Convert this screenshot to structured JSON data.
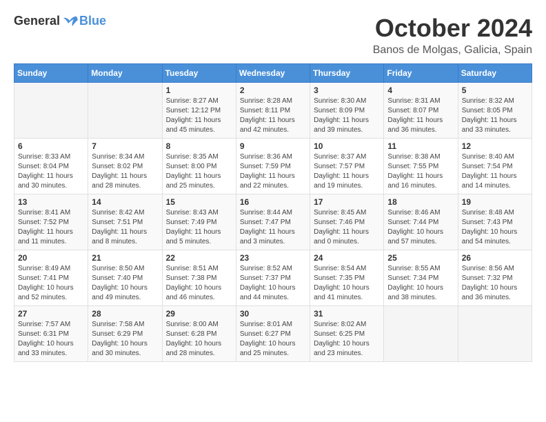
{
  "logo": {
    "general": "General",
    "blue": "Blue"
  },
  "title": "October 2024",
  "location": "Banos de Molgas, Galicia, Spain",
  "weekdays": [
    "Sunday",
    "Monday",
    "Tuesday",
    "Wednesday",
    "Thursday",
    "Friday",
    "Saturday"
  ],
  "weeks": [
    [
      {
        "day": "",
        "sunrise": "",
        "sunset": "",
        "daylight": ""
      },
      {
        "day": "",
        "sunrise": "",
        "sunset": "",
        "daylight": ""
      },
      {
        "day": "1",
        "sunrise": "Sunrise: 8:27 AM",
        "sunset": "Sunset: 12:12 PM",
        "daylight": "Daylight: 11 hours and 45 minutes."
      },
      {
        "day": "2",
        "sunrise": "Sunrise: 8:28 AM",
        "sunset": "Sunset: 8:11 PM",
        "daylight": "Daylight: 11 hours and 42 minutes."
      },
      {
        "day": "3",
        "sunrise": "Sunrise: 8:30 AM",
        "sunset": "Sunset: 8:09 PM",
        "daylight": "Daylight: 11 hours and 39 minutes."
      },
      {
        "day": "4",
        "sunrise": "Sunrise: 8:31 AM",
        "sunset": "Sunset: 8:07 PM",
        "daylight": "Daylight: 11 hours and 36 minutes."
      },
      {
        "day": "5",
        "sunrise": "Sunrise: 8:32 AM",
        "sunset": "Sunset: 8:05 PM",
        "daylight": "Daylight: 11 hours and 33 minutes."
      }
    ],
    [
      {
        "day": "6",
        "sunrise": "Sunrise: 8:33 AM",
        "sunset": "Sunset: 8:04 PM",
        "daylight": "Daylight: 11 hours and 30 minutes."
      },
      {
        "day": "7",
        "sunrise": "Sunrise: 8:34 AM",
        "sunset": "Sunset: 8:02 PM",
        "daylight": "Daylight: 11 hours and 28 minutes."
      },
      {
        "day": "8",
        "sunrise": "Sunrise: 8:35 AM",
        "sunset": "Sunset: 8:00 PM",
        "daylight": "Daylight: 11 hours and 25 minutes."
      },
      {
        "day": "9",
        "sunrise": "Sunrise: 8:36 AM",
        "sunset": "Sunset: 7:59 PM",
        "daylight": "Daylight: 11 hours and 22 minutes."
      },
      {
        "day": "10",
        "sunrise": "Sunrise: 8:37 AM",
        "sunset": "Sunset: 7:57 PM",
        "daylight": "Daylight: 11 hours and 19 minutes."
      },
      {
        "day": "11",
        "sunrise": "Sunrise: 8:38 AM",
        "sunset": "Sunset: 7:55 PM",
        "daylight": "Daylight: 11 hours and 16 minutes."
      },
      {
        "day": "12",
        "sunrise": "Sunrise: 8:40 AM",
        "sunset": "Sunset: 7:54 PM",
        "daylight": "Daylight: 11 hours and 14 minutes."
      }
    ],
    [
      {
        "day": "13",
        "sunrise": "Sunrise: 8:41 AM",
        "sunset": "Sunset: 7:52 PM",
        "daylight": "Daylight: 11 hours and 11 minutes."
      },
      {
        "day": "14",
        "sunrise": "Sunrise: 8:42 AM",
        "sunset": "Sunset: 7:51 PM",
        "daylight": "Daylight: 11 hours and 8 minutes."
      },
      {
        "day": "15",
        "sunrise": "Sunrise: 8:43 AM",
        "sunset": "Sunset: 7:49 PM",
        "daylight": "Daylight: 11 hours and 5 minutes."
      },
      {
        "day": "16",
        "sunrise": "Sunrise: 8:44 AM",
        "sunset": "Sunset: 7:47 PM",
        "daylight": "Daylight: 11 hours and 3 minutes."
      },
      {
        "day": "17",
        "sunrise": "Sunrise: 8:45 AM",
        "sunset": "Sunset: 7:46 PM",
        "daylight": "Daylight: 11 hours and 0 minutes."
      },
      {
        "day": "18",
        "sunrise": "Sunrise: 8:46 AM",
        "sunset": "Sunset: 7:44 PM",
        "daylight": "Daylight: 10 hours and 57 minutes."
      },
      {
        "day": "19",
        "sunrise": "Sunrise: 8:48 AM",
        "sunset": "Sunset: 7:43 PM",
        "daylight": "Daylight: 10 hours and 54 minutes."
      }
    ],
    [
      {
        "day": "20",
        "sunrise": "Sunrise: 8:49 AM",
        "sunset": "Sunset: 7:41 PM",
        "daylight": "Daylight: 10 hours and 52 minutes."
      },
      {
        "day": "21",
        "sunrise": "Sunrise: 8:50 AM",
        "sunset": "Sunset: 7:40 PM",
        "daylight": "Daylight: 10 hours and 49 minutes."
      },
      {
        "day": "22",
        "sunrise": "Sunrise: 8:51 AM",
        "sunset": "Sunset: 7:38 PM",
        "daylight": "Daylight: 10 hours and 46 minutes."
      },
      {
        "day": "23",
        "sunrise": "Sunrise: 8:52 AM",
        "sunset": "Sunset: 7:37 PM",
        "daylight": "Daylight: 10 hours and 44 minutes."
      },
      {
        "day": "24",
        "sunrise": "Sunrise: 8:54 AM",
        "sunset": "Sunset: 7:35 PM",
        "daylight": "Daylight: 10 hours and 41 minutes."
      },
      {
        "day": "25",
        "sunrise": "Sunrise: 8:55 AM",
        "sunset": "Sunset: 7:34 PM",
        "daylight": "Daylight: 10 hours and 38 minutes."
      },
      {
        "day": "26",
        "sunrise": "Sunrise: 8:56 AM",
        "sunset": "Sunset: 7:32 PM",
        "daylight": "Daylight: 10 hours and 36 minutes."
      }
    ],
    [
      {
        "day": "27",
        "sunrise": "Sunrise: 7:57 AM",
        "sunset": "Sunset: 6:31 PM",
        "daylight": "Daylight: 10 hours and 33 minutes."
      },
      {
        "day": "28",
        "sunrise": "Sunrise: 7:58 AM",
        "sunset": "Sunset: 6:29 PM",
        "daylight": "Daylight: 10 hours and 30 minutes."
      },
      {
        "day": "29",
        "sunrise": "Sunrise: 8:00 AM",
        "sunset": "Sunset: 6:28 PM",
        "daylight": "Daylight: 10 hours and 28 minutes."
      },
      {
        "day": "30",
        "sunrise": "Sunrise: 8:01 AM",
        "sunset": "Sunset: 6:27 PM",
        "daylight": "Daylight: 10 hours and 25 minutes."
      },
      {
        "day": "31",
        "sunrise": "Sunrise: 8:02 AM",
        "sunset": "Sunset: 6:25 PM",
        "daylight": "Daylight: 10 hours and 23 minutes."
      },
      {
        "day": "",
        "sunrise": "",
        "sunset": "",
        "daylight": ""
      },
      {
        "day": "",
        "sunrise": "",
        "sunset": "",
        "daylight": ""
      }
    ]
  ]
}
